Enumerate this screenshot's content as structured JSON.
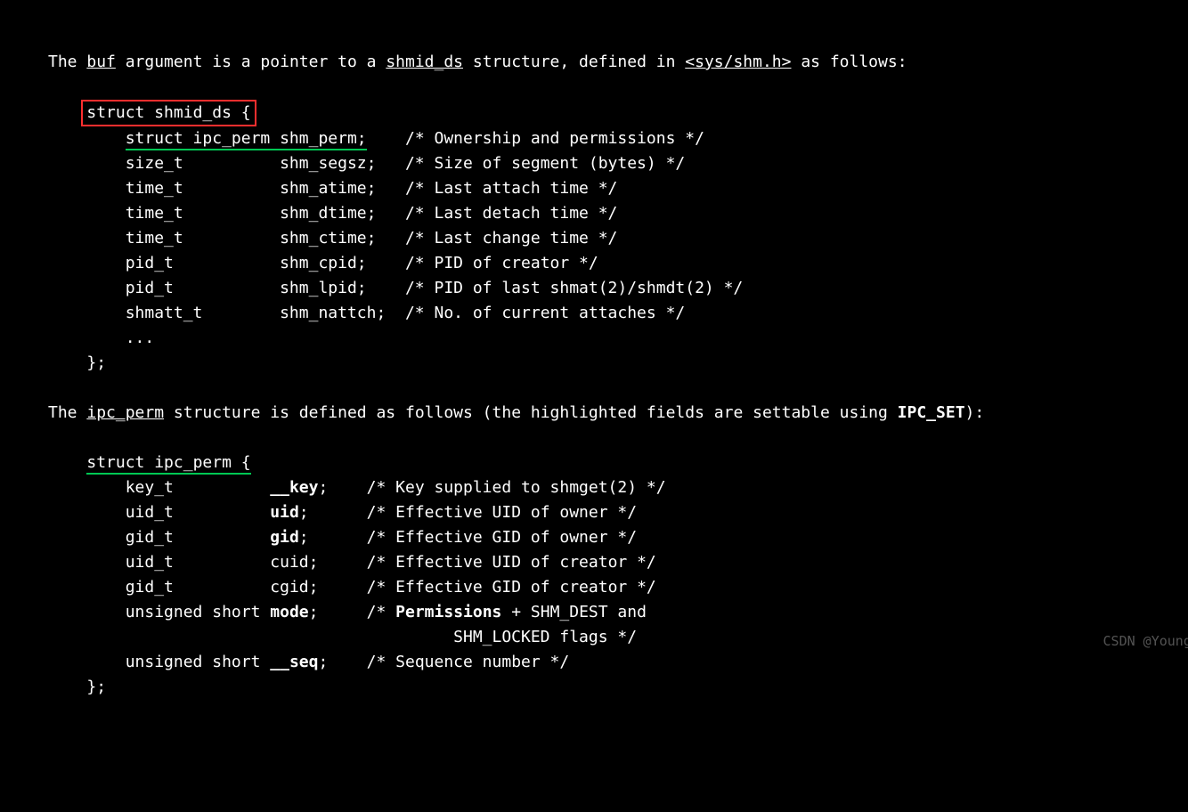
{
  "intro": {
    "p1": "The ",
    "buf": "buf",
    "p2": " argument is a pointer to a ",
    "shmid_ds": "shmid_ds",
    "p3": " structure, defined in ",
    "header": "<sys/shm.h>",
    "p4": " as follows:"
  },
  "shmid": {
    "head": "struct shmid_ds {",
    "f0": {
      "decl": "struct ipc_perm shm_perm;",
      "rest": "    /* Ownership and permissions */"
    },
    "f1": "size_t          shm_segsz;   /* Size of segment (bytes) */",
    "f2": "time_t          shm_atime;   /* Last attach time */",
    "f3": "time_t          shm_dtime;   /* Last detach time */",
    "f4": "time_t          shm_ctime;   /* Last change time */",
    "f5": "pid_t           shm_cpid;    /* PID of creator */",
    "f6": "pid_t           shm_lpid;    /* PID of last shmat(2)/shmdt(2) */",
    "f7": "shmatt_t        shm_nattch;  /* No. of current attaches */",
    "ell": "...",
    "close": "};"
  },
  "ipcintro": {
    "p1": "The ",
    "ipc": "ipc_perm",
    "p2": " structure is defined as follows (the highlighted fields are settable using ",
    "ipcset": "IPC_SET",
    "p3": "):"
  },
  "ipc": {
    "head": "struct ipc_perm {",
    "f0": {
      "t": "key_t          ",
      "n": "__key",
      "c": ";    /* Key supplied to shmget(2) */"
    },
    "f1": {
      "t": "uid_t          ",
      "n": "uid",
      "c": ";      /* Effective UID of owner */"
    },
    "f2": {
      "t": "gid_t          ",
      "n": "gid",
      "c": ";      /* Effective GID of owner */"
    },
    "f3": {
      "t": "uid_t          ",
      "n": "cuid",
      "c": ";     /* Effective UID of creator */"
    },
    "f4": {
      "t": "gid_t          ",
      "n": "cgid",
      "c": ";     /* Effective GID of creator */"
    },
    "f5": {
      "t": "unsigned short ",
      "n": "mode",
      "c1": ";     /* ",
      "perm": "Permissions",
      "c2": " + SHM_DEST and"
    },
    "f5b": "   SHM_LOCKED flags */",
    "f6": {
      "t": "unsigned short ",
      "n": "__seq",
      "c": ";    /* Sequence number */"
    },
    "close": "};"
  },
  "watermark": "CSDN @YoungMLet"
}
